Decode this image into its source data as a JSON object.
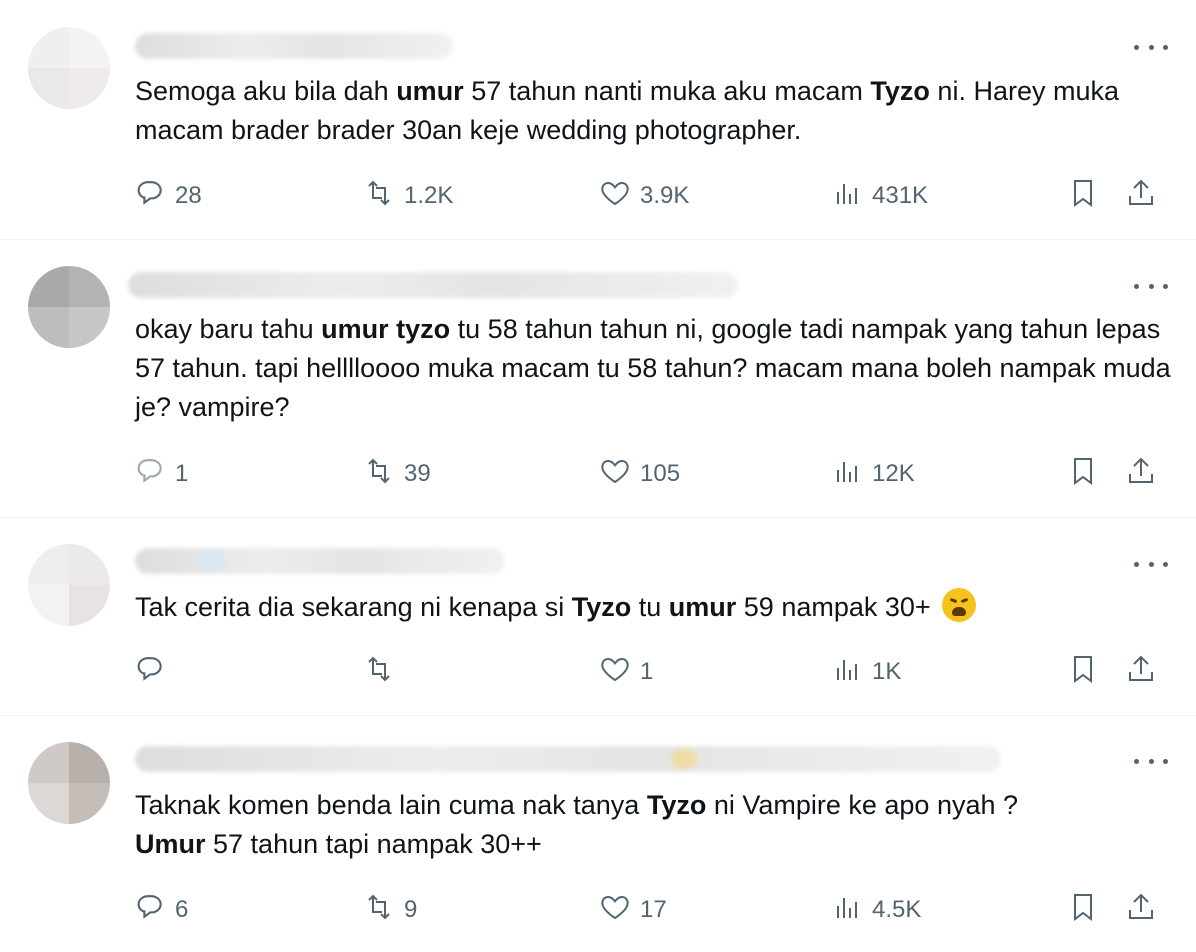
{
  "tweets": [
    {
      "text_parts": [
        {
          "t": "Semoga aku bila dah ",
          "b": false
        },
        {
          "t": "umur",
          "b": true
        },
        {
          "t": " 57 tahun nanti muka aku macam ",
          "b": false
        },
        {
          "t": "Tyzo",
          "b": true
        },
        {
          "t": " ni. Harey muka macam brader brader 30an keje wedding photographer.",
          "b": false
        }
      ],
      "replies": "28",
      "retweets": "1.2K",
      "likes": "3.9K",
      "views": "431K"
    },
    {
      "text_parts": [
        {
          "t": "okay baru tahu ",
          "b": false
        },
        {
          "t": "umur tyzo",
          "b": true
        },
        {
          "t": " tu 58 tahun tahun ni, google tadi nampak yang tahun lepas 57 tahun. tapi helllloooo muka macam tu 58 tahun? macam mana boleh nampak muda je? vampire?",
          "b": false
        }
      ],
      "replies": "1",
      "retweets": "39",
      "likes": "105",
      "views": "12K"
    },
    {
      "text_parts": [
        {
          "t": "Tak cerita dia sekarang ni kenapa si ",
          "b": false
        },
        {
          "t": "Tyzo",
          "b": true
        },
        {
          "t": " tu ",
          "b": false
        },
        {
          "t": "umur",
          "b": true
        },
        {
          "t": " 59 nampak 30+",
          "b": false
        }
      ],
      "emoji": "weary-face-emoji",
      "replies": "",
      "retweets": "",
      "likes": "1",
      "views": "1K"
    },
    {
      "text_parts": [
        {
          "t": "Taknak komen benda lain cuma nak tanya ",
          "b": false
        },
        {
          "t": "Tyzo",
          "b": true
        },
        {
          "t": " ni Vampire ke apo nyah ?",
          "b": false
        },
        {
          "br": true
        },
        {
          "t": "Umur",
          "b": true
        },
        {
          "t": " 57 tahun tapi nampak 30++",
          "b": false
        }
      ],
      "replies": "6",
      "retweets": "9",
      "likes": "17",
      "views": "4.5K"
    }
  ],
  "icons": {
    "reply": "reply-icon",
    "retweet": "retweet-icon",
    "like": "like-icon",
    "views": "views-icon",
    "bookmark": "bookmark-icon",
    "share": "share-icon",
    "more": "more-icon"
  },
  "colors": {
    "text": "#0f1419",
    "secondary": "#536471",
    "divider": "#eff3f4"
  }
}
